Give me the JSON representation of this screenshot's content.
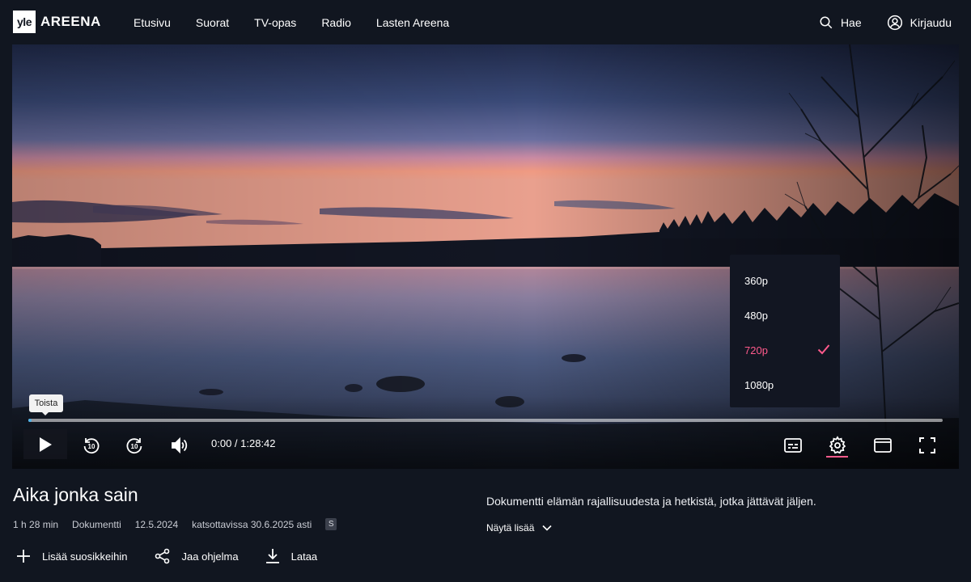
{
  "header": {
    "logo_mark": "yle",
    "logo_text": "AREENA",
    "nav": [
      "Etusivu",
      "Suorat",
      "TV-opas",
      "Radio",
      "Lasten Areena"
    ],
    "search_label": "Hae",
    "login_label": "Kirjaudu"
  },
  "player": {
    "tooltip": "Toista",
    "time": "0:00 / 1:28:42",
    "progress": 0,
    "quality_options": [
      "360p",
      "480p",
      "720p",
      "1080p"
    ],
    "quality_selected": "720p",
    "icons": {
      "play": "play-icon",
      "rewind": "rewind-10-icon",
      "forward": "forward-10-icon",
      "volume": "volume-icon",
      "subtitles": "subtitles-icon",
      "settings": "settings-gear-icon",
      "theater": "theater-mode-icon",
      "fullscreen": "fullscreen-icon"
    },
    "accent_color": "#ff5a8c",
    "progress_color": "#4fb3e8"
  },
  "program": {
    "title": "Aika jonka sain",
    "duration": "1 h 28 min",
    "genre": "Dokumentti",
    "date": "12.5.2024",
    "availability": "katsottavissa 30.6.2025 asti",
    "badge": "S",
    "description": "Dokumentti elämän rajallisuudesta ja hetkistä, jotka jättävät jäljen.",
    "more_label": "Näytä lisää"
  },
  "actions": {
    "favorite": "Lisää suosikkeihin",
    "share": "Jaa ohjelma",
    "download": "Lataa"
  }
}
